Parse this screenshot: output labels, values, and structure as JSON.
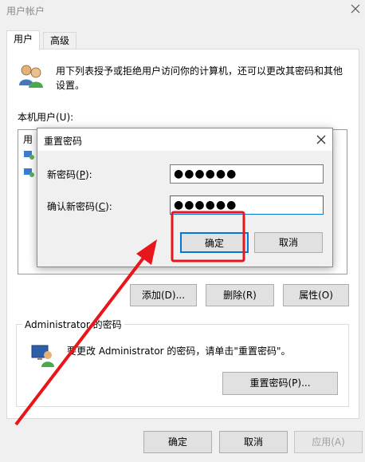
{
  "window": {
    "title": "用户帐户"
  },
  "tabs": [
    {
      "label": "用户"
    },
    {
      "label": "高级"
    }
  ],
  "intro_text": "用下列表授予或拒绝用户访问你的计算机，还可以更改其密码和其他设置。",
  "users_label": "本机用户(U):",
  "list_column_fragment": "用",
  "buttons": {
    "add": "添加(D)...",
    "remove": "删除(R)",
    "properties": "属性(O)",
    "reset_password": "重置密码(P)...",
    "ok": "确定",
    "cancel": "取消",
    "apply": "应用(A)"
  },
  "admin_group": {
    "label": "Administrator 的密码",
    "text": "要更改 Administrator 的密码，请单击\"重置密码\"。"
  },
  "dialog": {
    "title": "重置密码",
    "new_password_label": "新密码(P):",
    "confirm_label": "确认新密码(C):",
    "new_password_value": "●●●●●●",
    "confirm_value": "●●●●●●",
    "ok": "确定",
    "cancel": "取消"
  },
  "annotation": {
    "highlight_color": "#e8161b"
  }
}
